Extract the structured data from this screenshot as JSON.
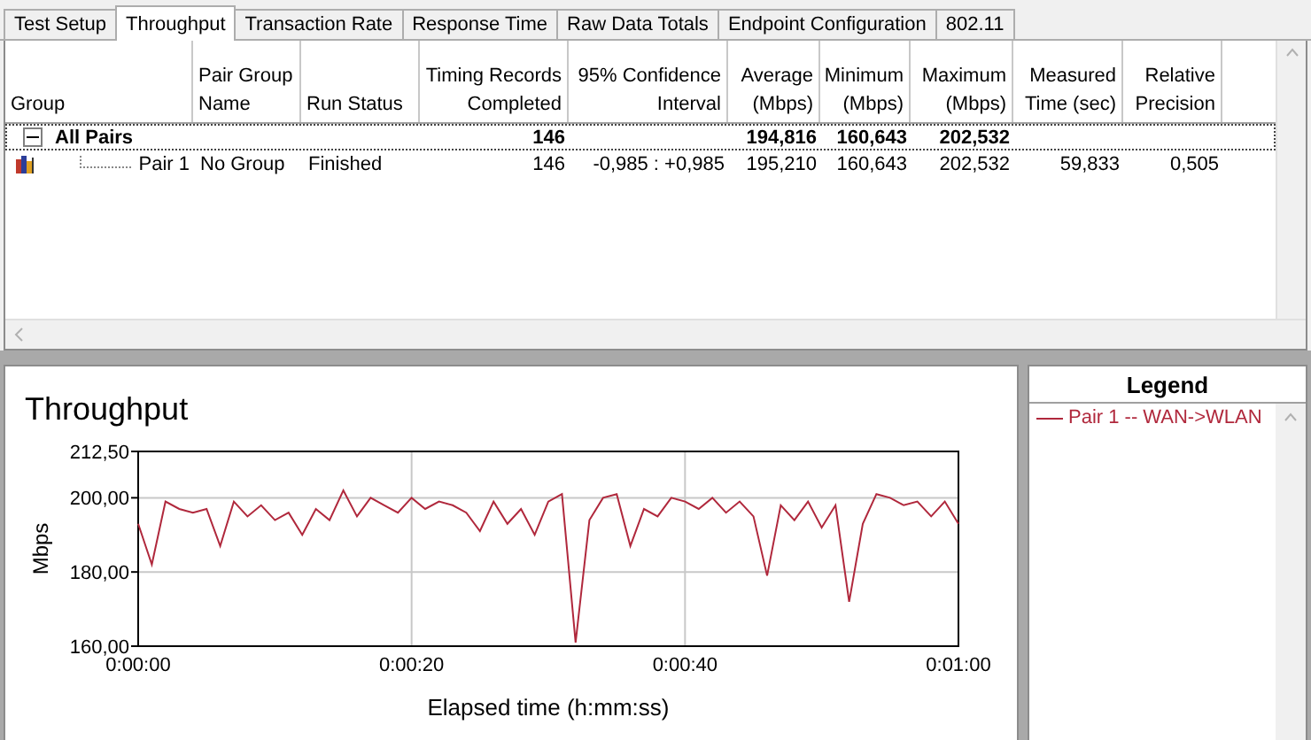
{
  "tabs": [
    {
      "label": "Test Setup",
      "selected": false
    },
    {
      "label": "Throughput",
      "selected": true
    },
    {
      "label": "Transaction Rate",
      "selected": false
    },
    {
      "label": "Response Time",
      "selected": false
    },
    {
      "label": "Raw Data Totals",
      "selected": false
    },
    {
      "label": "Endpoint Configuration",
      "selected": false
    },
    {
      "label": "802.11",
      "selected": false
    }
  ],
  "table": {
    "columns": [
      "Group",
      "Pair Group\nName",
      "Run Status",
      "Timing Records\nCompleted",
      "95% Confidence\nInterval",
      "Average\n(Mbps)",
      "Minimum\n(Mbps)",
      "Maximum\n(Mbps)",
      "Measured\nTime (sec)",
      "Relative\nPrecision"
    ],
    "rows": [
      {
        "kind": "group",
        "expanded": true,
        "selected": true,
        "group": "All Pairs",
        "timing_records": "146",
        "average": "194,816",
        "minimum": "160,643",
        "maximum": "202,532"
      },
      {
        "kind": "pair",
        "selected": false,
        "group": "Pair 1",
        "pair_group_name": "No Group",
        "run_status": "Finished",
        "timing_records": "146",
        "confidence": "-0,985 : +0,985",
        "average": "195,210",
        "minimum": "160,643",
        "maximum": "202,532",
        "measured_time": "59,833",
        "relative_precision": "0,505"
      }
    ]
  },
  "chart": {
    "legend_title": "Legend",
    "chart_data": {
      "type": "line",
      "title": "Throughput",
      "xlabel": "Elapsed time (h:mm:ss)",
      "ylabel": "Mbps",
      "x": [
        0,
        1,
        2,
        3,
        4,
        5,
        6,
        7,
        8,
        9,
        10,
        11,
        12,
        13,
        14,
        15,
        16,
        17,
        18,
        19,
        20,
        21,
        22,
        23,
        24,
        25,
        26,
        27,
        28,
        29,
        30,
        31,
        32,
        33,
        34,
        35,
        36,
        37,
        38,
        39,
        40,
        41,
        42,
        43,
        44,
        45,
        46,
        47,
        48,
        49,
        50,
        51,
        52,
        53,
        54,
        55,
        56,
        57,
        58,
        59,
        60
      ],
      "series": [
        {
          "name": "Pair 1 -- WAN->WLAN",
          "color": "#b0283c",
          "values": [
            193,
            182,
            199,
            197,
            196,
            197,
            187,
            199,
            195,
            198,
            194,
            196,
            190,
            197,
            194,
            202,
            195,
            200,
            198,
            196,
            200,
            197,
            199,
            198,
            196,
            191,
            199,
            193,
            197,
            190,
            199,
            201,
            161,
            194,
            200,
            201,
            187,
            197,
            195,
            200,
            199,
            197,
            200,
            196,
            199,
            195,
            179,
            198,
            194,
            199,
            192,
            198,
            172,
            193,
            201,
            200,
            198,
            199,
            195,
            199,
            193
          ]
        }
      ],
      "grid": true,
      "xlim": [
        0,
        60
      ],
      "ylim": [
        160,
        212.5
      ],
      "xticks": [
        {
          "value": 0,
          "label": "0:00:00"
        },
        {
          "value": 20,
          "label": "0:00:20"
        },
        {
          "value": 40,
          "label": "0:00:40"
        },
        {
          "value": 60,
          "label": "0:01:00"
        }
      ],
      "yticks": [
        {
          "value": 160,
          "label": "160,00"
        },
        {
          "value": 180,
          "label": "180,00"
        },
        {
          "value": 200,
          "label": "200,00"
        },
        {
          "value": 212.5,
          "label": "212,50"
        }
      ]
    }
  }
}
